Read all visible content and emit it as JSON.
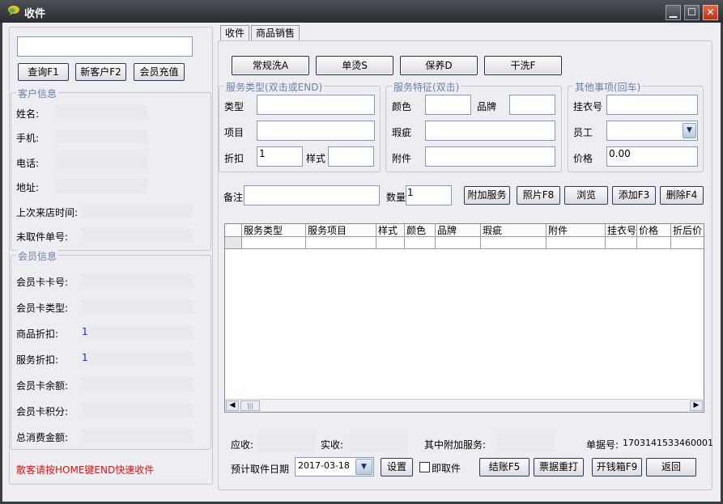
{
  "window": {
    "title": "收件"
  },
  "left": {
    "query_btn": "查询F1",
    "new_customer_btn": "新客户F2",
    "recharge_btn": "会员充值",
    "customer_section": "客户信息",
    "fields": {
      "name": "姓名:",
      "mobile": "手机:",
      "phone": "电话:",
      "address": "地址:",
      "last_visit": "上次来店时间:",
      "uncollected": "未取件单号:"
    },
    "member_section": "会员信息",
    "member_fields": {
      "card_no": "会员卡卡号:",
      "card_type": "会员卡类型:",
      "goods_discount": "商品折扣:",
      "goods_discount_val": "1",
      "service_discount": "服务折扣:",
      "service_discount_val": "1",
      "balance": "会员卡余额:",
      "points": "会员卡积分:",
      "total": "总消费金额:"
    },
    "hint": "散客请按HOME键END快速收件"
  },
  "tabs": [
    "收件",
    "商品销售"
  ],
  "service_buttons": [
    "常规洗A",
    "单烫S",
    "保养D",
    "干洗F"
  ],
  "service_type": {
    "title": "服务类型(双击或END)",
    "type": "类型",
    "item": "项目",
    "discount": "折扣",
    "discount_val": "1",
    "style": "样式"
  },
  "service_feature": {
    "title": "服务特征(双击)",
    "color": "颜色",
    "brand": "品牌",
    "defect": "瑕疵",
    "attachment": "附件"
  },
  "other": {
    "title": "其他事项(回车)",
    "hanger": "挂衣号",
    "staff": "员工",
    "price": "价格",
    "price_val": "0.00"
  },
  "remark": "备注",
  "quantity": "数量",
  "quantity_val": "1",
  "action_buttons": [
    "附加服务",
    "照片F8",
    "浏览",
    "添加F3",
    "删除F4"
  ],
  "table": {
    "columns": [
      "服务类型",
      "服务项目",
      "样式",
      "颜色",
      "品牌",
      "瑕疵",
      "附件",
      "挂衣号",
      "价格",
      "折后价"
    ]
  },
  "footer": {
    "receivable": "应收:",
    "received": "实收:",
    "extra_service": "其中附加服务:",
    "order_no_label": "单据号:",
    "order_no": "1703141533460001",
    "pickup_date_label": "预计取件日期",
    "pickup_date": "2017-03-18",
    "settings_btn": "设置",
    "instant_pickup": "即取件",
    "buttons": [
      "结账F5",
      "票据重打",
      "开钱箱F9",
      "返回"
    ]
  },
  "colors": {
    "accent_blue": "#1a2fbf",
    "hint_red": "#e01010",
    "section_title": "#6a7fa6"
  }
}
